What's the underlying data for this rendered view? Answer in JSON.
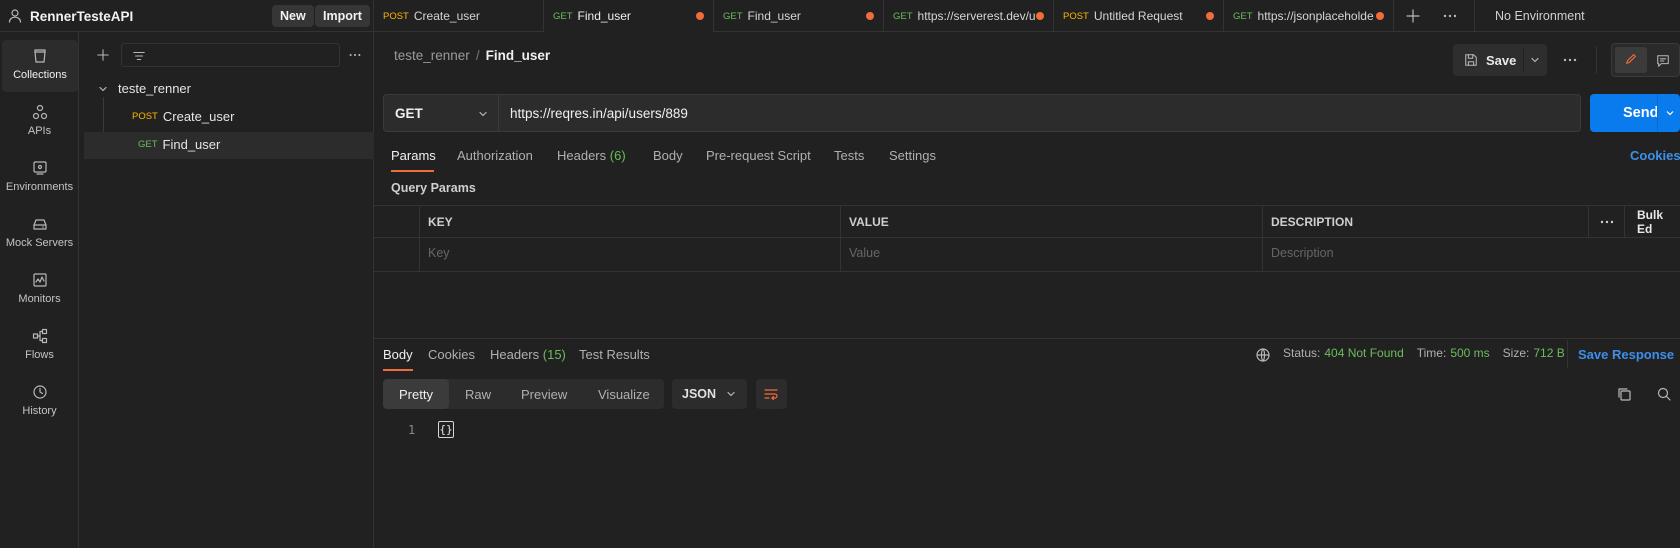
{
  "workspace": {
    "name": "RennerTesteAPI",
    "new_label": "New",
    "import_label": "Import"
  },
  "tabs": [
    {
      "method": "POST",
      "title": "Create_user",
      "modified": false
    },
    {
      "method": "GET",
      "title": "Find_user",
      "modified": true,
      "active": true
    },
    {
      "method": "GET",
      "title": "Find_user",
      "modified": true
    },
    {
      "method": "GET",
      "title": "https://serverest.dev/u",
      "modified": true
    },
    {
      "method": "POST",
      "title": "Untitled Request",
      "modified": true
    },
    {
      "method": "GET",
      "title": "https://jsonplaceholde",
      "modified": true
    }
  ],
  "environment": "No Environment",
  "leftnav": [
    {
      "label": "Collections",
      "icon": "collections-icon"
    },
    {
      "label": "APIs",
      "icon": "apis-icon"
    },
    {
      "label": "Environments",
      "icon": "environments-icon"
    },
    {
      "label": "Mock Servers",
      "icon": "mock-servers-icon"
    },
    {
      "label": "Monitors",
      "icon": "monitors-icon"
    },
    {
      "label": "Flows",
      "icon": "flows-icon"
    },
    {
      "label": "History",
      "icon": "history-icon"
    }
  ],
  "sidebar": {
    "collection": "teste_renner",
    "requests": [
      {
        "method": "POST",
        "name": "Create_user"
      },
      {
        "method": "GET",
        "name": "Find_user"
      }
    ]
  },
  "request": {
    "breadcrumb_collection": "teste_renner",
    "breadcrumb_sep": "/",
    "name": "Find_user",
    "save_label": "Save",
    "method": "GET",
    "url": "https://reqres.in/api/users/889",
    "send_label": "Send",
    "tabs": [
      "Params",
      "Authorization",
      "Headers",
      "Body",
      "Pre-request Script",
      "Tests",
      "Settings"
    ],
    "headers_count": "(6)",
    "cookies_label": "Cookies",
    "query_params_label": "Query Params",
    "columns": [
      "KEY",
      "VALUE",
      "DESCRIPTION"
    ],
    "bulk_edit_label": "Bulk Ed",
    "placeholders": [
      "Key",
      "Value",
      "Description"
    ]
  },
  "response": {
    "tabs": [
      "Body",
      "Cookies",
      "Headers",
      "Test Results"
    ],
    "headers_count": "(15)",
    "status_label": "Status:",
    "status_value": "404 Not Found",
    "time_label": "Time:",
    "time_value": "500 ms",
    "size_label": "Size:",
    "size_value": "712 B",
    "save_response_label": "Save Response",
    "formats": [
      "Pretty",
      "Raw",
      "Preview",
      "Visualize"
    ],
    "language": "JSON",
    "line_number": "1",
    "body_glyph": "{}"
  },
  "colors": {
    "accent": "#f26b3a",
    "send": "#097bed",
    "get": "#6bbd5b",
    "post": "#ffb400",
    "link": "#3d8fe9"
  }
}
